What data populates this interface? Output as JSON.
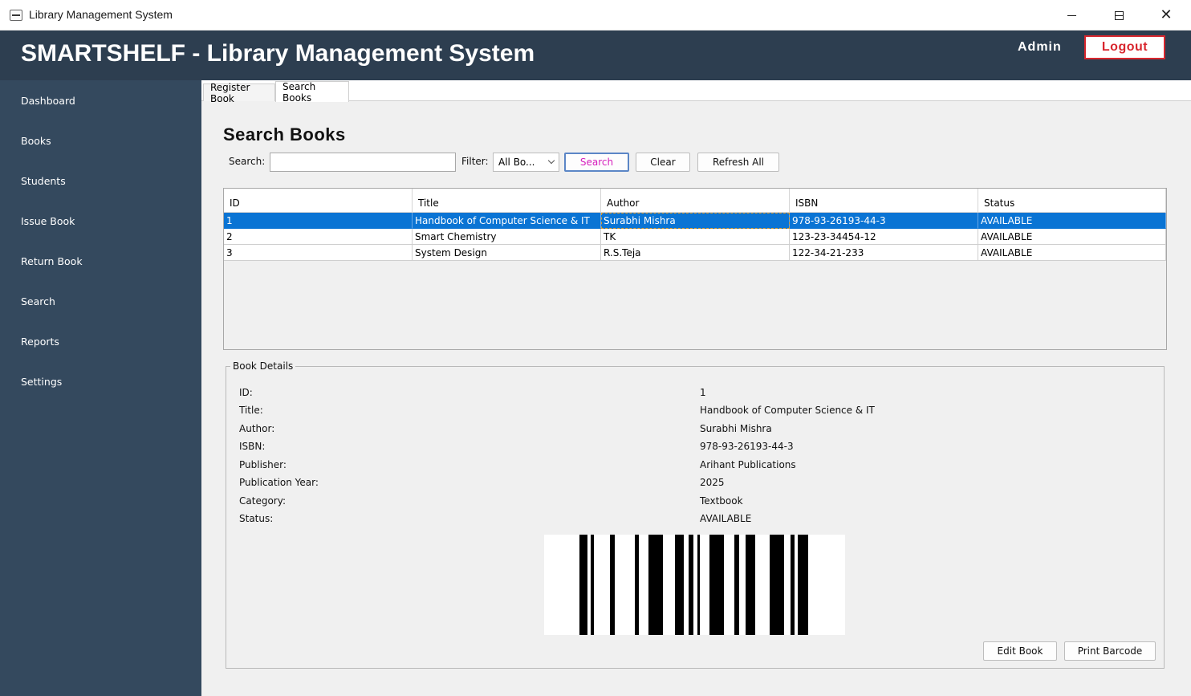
{
  "window": {
    "title": "Library Management System",
    "controls": [
      "minimize-icon",
      "maximize-icon",
      "close-icon"
    ]
  },
  "header": {
    "title": "SMARTSHELF - Library Management System",
    "user": "Admin",
    "logout_label": "Logout"
  },
  "sidebar": {
    "items": [
      {
        "label": "Dashboard"
      },
      {
        "label": "Books"
      },
      {
        "label": "Students"
      },
      {
        "label": "Issue Book"
      },
      {
        "label": "Return Book"
      },
      {
        "label": "Search"
      },
      {
        "label": "Reports"
      },
      {
        "label": "Settings"
      }
    ]
  },
  "tabs": [
    {
      "label": "Register Book",
      "active": false
    },
    {
      "label": "Search Books",
      "active": true
    }
  ],
  "search_panel": {
    "title": "Search Books",
    "search_label": "Search:",
    "search_value": "",
    "filter_label": "Filter:",
    "filter_value": "All Bo...",
    "search_button": "Search",
    "clear_button": "Clear",
    "refresh_button": "Refresh All"
  },
  "table": {
    "columns": [
      "ID",
      "Title",
      "Author",
      "ISBN",
      "Status"
    ],
    "rows": [
      [
        "1",
        "Handbook of Computer Science & IT",
        "Surabhi Mishra",
        "978-93-26193-44-3",
        "AVAILABLE"
      ],
      [
        "2",
        "Smart Chemistry",
        "TK",
        "123-23-34454-12",
        "AVAILABLE"
      ],
      [
        "3",
        "System Design",
        "R.S.Teja",
        "122-34-21-233",
        "AVAILABLE"
      ]
    ],
    "selected_row": 0
  },
  "details": {
    "legend": "Book Details",
    "fields": [
      {
        "label": "ID:",
        "value": "1"
      },
      {
        "label": "Title:",
        "value": "Handbook of Computer Science & IT"
      },
      {
        "label": "Author:",
        "value": "Surabhi Mishra"
      },
      {
        "label": "ISBN:",
        "value": "978-93-26193-44-3"
      },
      {
        "label": "Publisher:",
        "value": "Arihant Publications"
      },
      {
        "label": "Publication Year:",
        "value": "2025"
      },
      {
        "label": "Category:",
        "value": "Textbook"
      },
      {
        "label": "Status:",
        "value": "AVAILABLE"
      }
    ],
    "edit_button": "Edit Book",
    "print_button": "Print Barcode"
  },
  "colors": {
    "header_bg": "#2d3e50",
    "sidebar_bg": "#34495e",
    "selection": "#0a74d4",
    "logout_red": "#d8262e"
  }
}
